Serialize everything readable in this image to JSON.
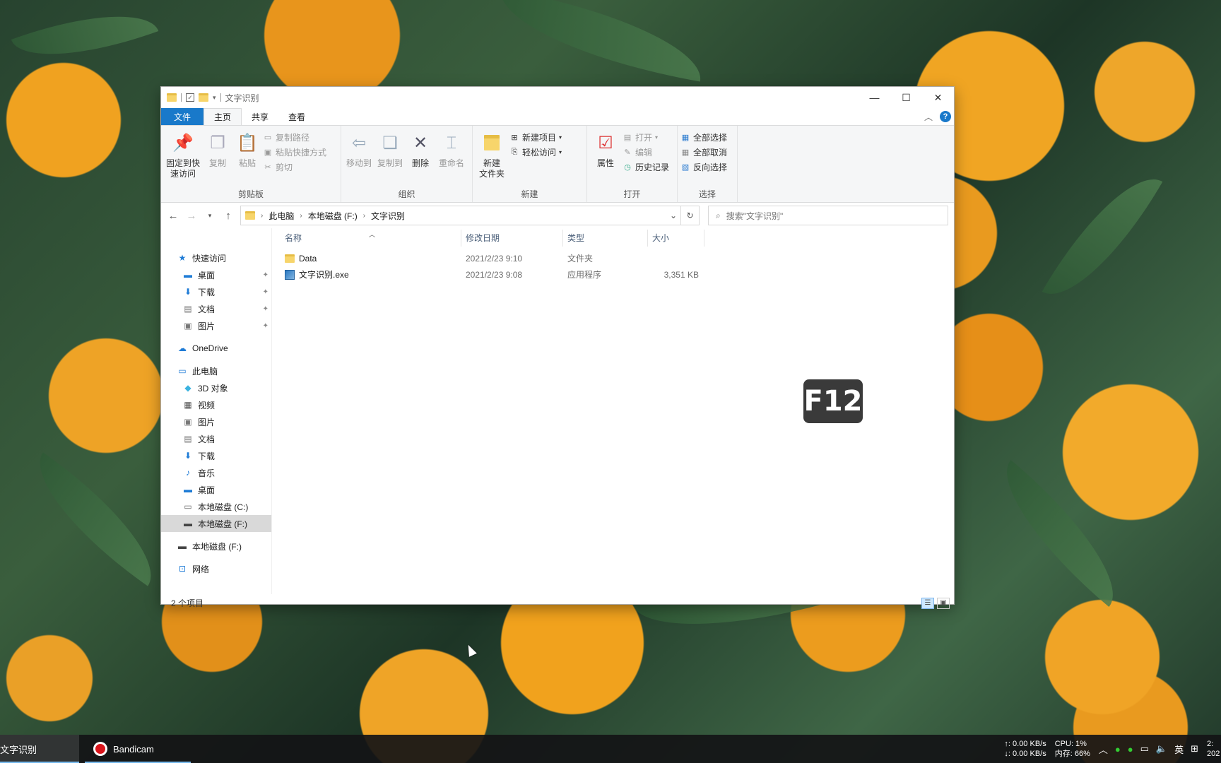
{
  "window": {
    "title": "文字识别",
    "tabs": [
      "文件",
      "主页",
      "共享",
      "查看"
    ],
    "active_tab": "主页"
  },
  "ribbon": {
    "clipboard": {
      "label": "剪贴板",
      "pin": "固定到快\n速访问",
      "copy": "复制",
      "paste": "粘贴",
      "copy_path": "复制路径",
      "paste_shortcut": "粘贴快捷方式",
      "cut": "剪切"
    },
    "organize": {
      "label": "组织",
      "move_to": "移动到",
      "copy_to": "复制到",
      "delete": "删除",
      "rename": "重命名"
    },
    "new": {
      "label": "新建",
      "new_folder": "新建\n文件夹",
      "new_item": "新建项目",
      "easy_access": "轻松访问"
    },
    "open": {
      "label": "打开",
      "properties": "属性",
      "open": "打开",
      "edit": "编辑",
      "history": "历史记录"
    },
    "select": {
      "label": "选择",
      "select_all": "全部选择",
      "select_none": "全部取消",
      "invert": "反向选择"
    }
  },
  "address": {
    "crumbs": [
      "此电脑",
      "本地磁盘 (F:)",
      "文字识别"
    ],
    "search_placeholder": "搜索\"文字识别\""
  },
  "nav": {
    "quick_access": "快速访问",
    "quick_items": [
      "桌面",
      "下载",
      "文档",
      "图片"
    ],
    "onedrive": "OneDrive",
    "this_pc": "此电脑",
    "pc_items": [
      "3D 对象",
      "视频",
      "图片",
      "文档",
      "下载",
      "音乐",
      "桌面",
      "本地磁盘 (C:)",
      "本地磁盘 (F:)"
    ],
    "drive_f": "本地磁盘 (F:)",
    "network": "网络"
  },
  "columns": {
    "name": "名称",
    "date": "修改日期",
    "type": "类型",
    "size": "大小"
  },
  "files": [
    {
      "name": "Data",
      "date": "2021/2/23 9:10",
      "type": "文件夹",
      "size": ""
    },
    {
      "name": "文字识别.exe",
      "date": "2021/2/23 9:08",
      "type": "应用程序",
      "size": "3,351 KB"
    }
  ],
  "status": {
    "item_count": "2 个项目"
  },
  "key_overlay": "F12",
  "taskbar": {
    "items": [
      "文字识别",
      "Bandicam"
    ],
    "net_up": "↑: 0.00 KB/s",
    "net_down": "↓: 0.00 KB/s",
    "cpu": "CPU: 1%",
    "mem": "内存: 66%",
    "ime": "英",
    "clock_time": "2:",
    "clock_date": "202"
  }
}
